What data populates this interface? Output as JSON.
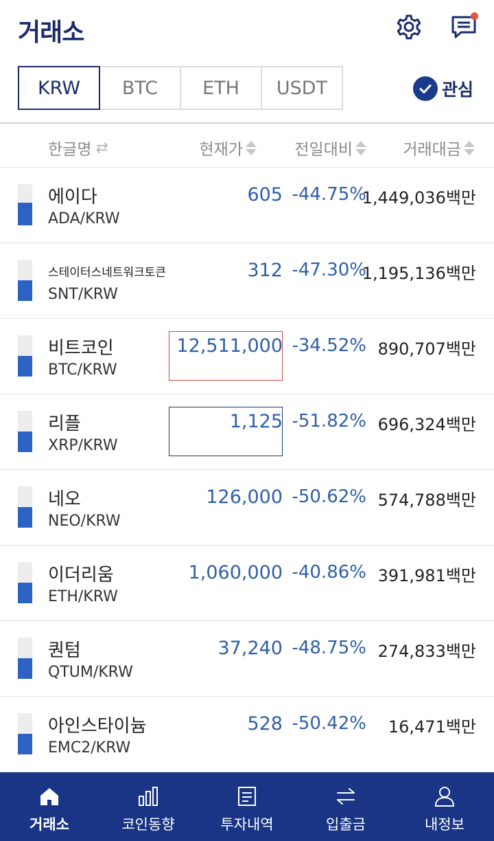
{
  "header": {
    "title": "거래소",
    "settings_icon": "gear-icon",
    "message_icon": "chat-icon",
    "has_notification": true
  },
  "market_tabs": [
    {
      "label": "KRW",
      "active": true
    },
    {
      "label": "BTC",
      "active": false
    },
    {
      "label": "ETH",
      "active": false
    },
    {
      "label": "USDT",
      "active": false
    }
  ],
  "favorites": {
    "label": "관심",
    "checked": true
  },
  "columns": {
    "name": "한글명",
    "price": "현재가",
    "change": "전일대비",
    "volume": "거래대금"
  },
  "colors": {
    "brand_navy": "#1a2b6b",
    "price_blue": "#2e5fa8",
    "nav_bg": "#1a3585",
    "notify_red": "#e5533b",
    "highlight_red": "#c9483a"
  },
  "coins": [
    {
      "name": "에이다",
      "pair": "ADA/KRW",
      "price": "605",
      "change": "-44.75%",
      "volume": "1,449,036백만",
      "bar_level": 0.55,
      "highlight": ""
    },
    {
      "name": "스테이터스네트워크토큰",
      "pair": "SNT/KRW",
      "price": "312",
      "change": "-47.30%",
      "volume": "1,195,136백만",
      "bar_level": 0.5,
      "highlight": ""
    },
    {
      "name": "비트코인",
      "pair": "BTC/KRW",
      "price": "12,511,000",
      "change": "-34.52%",
      "volume": "890,707백만",
      "bar_level": 0.5,
      "highlight": "red"
    },
    {
      "name": "리플",
      "pair": "XRP/KRW",
      "price": "1,125",
      "change": "-51.82%",
      "volume": "696,324백만",
      "bar_level": 0.5,
      "highlight": "navy"
    },
    {
      "name": "네오",
      "pair": "NEO/KRW",
      "price": "126,000",
      "change": "-50.62%",
      "volume": "574,788백만",
      "bar_level": 0.5,
      "highlight": ""
    },
    {
      "name": "이더리움",
      "pair": "ETH/KRW",
      "price": "1,060,000",
      "change": "-40.86%",
      "volume": "391,981백만",
      "bar_level": 0.5,
      "highlight": ""
    },
    {
      "name": "퀀텀",
      "pair": "QTUM/KRW",
      "price": "37,240",
      "change": "-48.75%",
      "volume": "274,833백만",
      "bar_level": 0.5,
      "highlight": ""
    },
    {
      "name": "아인스타이늄",
      "pair": "EMC2/KRW",
      "price": "528",
      "change": "-50.42%",
      "volume": "16,471백만",
      "bar_level": 0.5,
      "highlight": ""
    }
  ],
  "bottom_nav": [
    {
      "label": "거래소",
      "icon": "home-icon",
      "active": true
    },
    {
      "label": "코인동향",
      "icon": "bar-chart-icon",
      "active": false
    },
    {
      "label": "투자내역",
      "icon": "document-icon",
      "active": false
    },
    {
      "label": "입출금",
      "icon": "transfer-arrows-icon",
      "active": false
    },
    {
      "label": "내정보",
      "icon": "user-icon",
      "active": false
    }
  ]
}
